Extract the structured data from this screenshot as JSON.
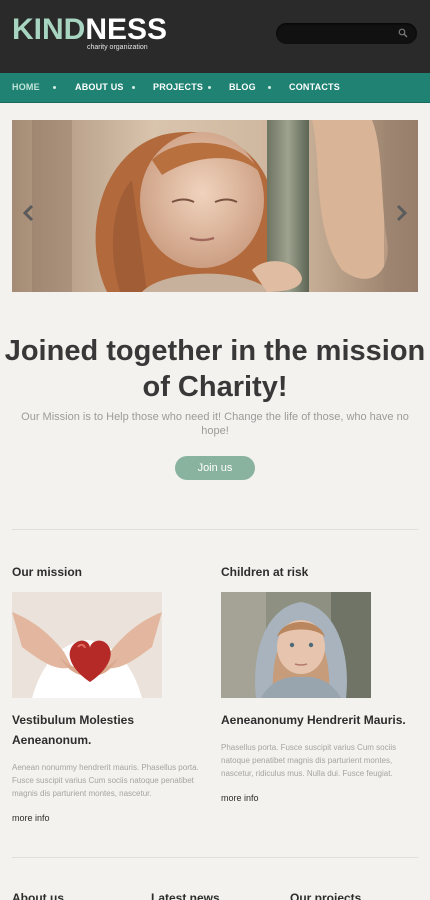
{
  "brand": {
    "logo_part1": "KIND",
    "logo_part2": "NESS",
    "tagline": "charity organization"
  },
  "search": {
    "placeholder": "",
    "icon": "search-icon"
  },
  "nav": {
    "items": [
      {
        "label": "HOME",
        "active": true
      },
      {
        "label": "ABOUT US"
      },
      {
        "label": "PROJECTS"
      },
      {
        "label": "BLOG"
      },
      {
        "label": "CONTACTS"
      }
    ]
  },
  "hero": {
    "headline_line1": "Joined together in the mission",
    "headline_line2": "of Charity!",
    "subtitle": "Our Mission is to Help those who need it! Change the life of those, who have no hope!",
    "button": "Join us"
  },
  "columns": [
    {
      "title": "Our mission",
      "post_title_1": "Vestibulum Molesties",
      "post_title_2": "Aeneanonum.",
      "body": "Aenean nonummy hendrerit mauris. Phasellus porta. Fusce suscipit varius Cum sociis natoque penatibet magnis dis parturient montes, nascetur.",
      "more": "more info",
      "image": "hands-heart"
    },
    {
      "title": "Children at risk",
      "post_title_1": "Aeneanonumy Hendrerit Mauris.",
      "post_title_2": "",
      "body": "Phasellus porta.  Fusce suscipit varius Cum sociis natoque penatibet magnis dis parturient montes, nascetur, ridiculus mus. Nulla dui. Fusce feugiat.",
      "more": "more info",
      "image": "girl-hood"
    }
  ],
  "footer_titles": [
    "About us",
    "Latest news",
    "Our projects"
  ],
  "colors": {
    "accent": "#1f8273",
    "button": "#89b39f",
    "header": "#2a2a2a"
  }
}
